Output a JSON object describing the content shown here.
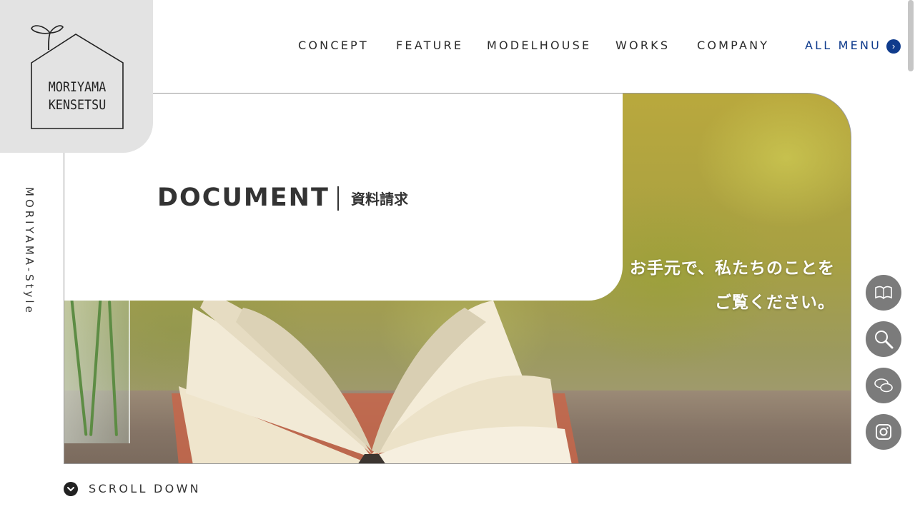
{
  "logo": {
    "line1": "MORIYAMA",
    "line2": "KENSETSU",
    "icon": "house-sprout-logo"
  },
  "side_text": "MORIYAMA-Style",
  "nav": {
    "items": [
      "CONCEPT",
      "FEATURE",
      "MODELHOUSE",
      "WORKS",
      "COMPANY"
    ],
    "all_menu": "ALL MENU",
    "all_menu_icon": "chevron-right-icon"
  },
  "hero": {
    "title": "DOCUMENT",
    "subtitle": "資料請求",
    "tagline_line1": "お手元で、私たちのことを",
    "tagline_line2": "ご覧ください。",
    "image": "open-book-on-table-photo"
  },
  "side_buttons": [
    {
      "icon": "book-icon"
    },
    {
      "icon": "magnifier-icon"
    },
    {
      "icon": "chat-bubbles-icon"
    },
    {
      "icon": "instagram-icon"
    }
  ],
  "scroll_down": {
    "label": "SCROLL DOWN",
    "icon": "chevron-down-icon"
  },
  "colors": {
    "accent": "#0f3b8c",
    "logo_bg": "#e3e3e3",
    "text": "#333333",
    "button_bg": "#7b7b7b"
  }
}
